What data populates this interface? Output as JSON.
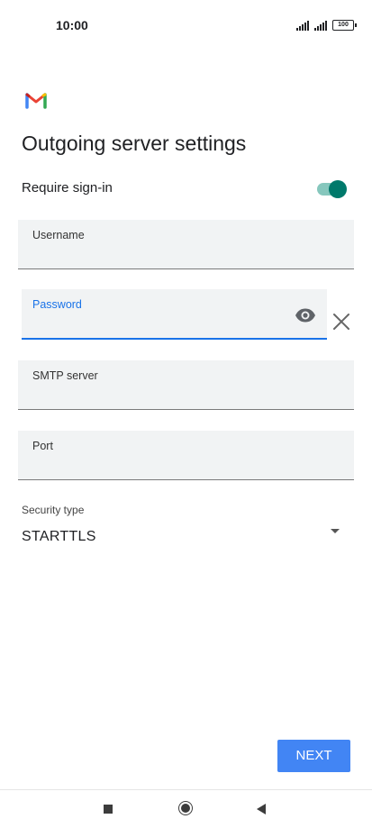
{
  "status_bar": {
    "time": "10:00",
    "battery": "100"
  },
  "header": {
    "title": "Outgoing server settings"
  },
  "require_signin": {
    "label": "Require sign-in",
    "enabled": true
  },
  "fields": {
    "username": {
      "label": "Username",
      "value": ""
    },
    "password": {
      "label": "Password",
      "value": ""
    },
    "smtp": {
      "label": "SMTP server",
      "value": ""
    },
    "port": {
      "label": "Port",
      "value": ""
    }
  },
  "security": {
    "label": "Security type",
    "value": "STARTTLS"
  },
  "actions": {
    "next_label": "NEXT"
  },
  "icons": [
    "gmail-logo",
    "eye-icon",
    "close-icon",
    "dropdown-arrow-icon",
    "signal-icon",
    "battery-icon",
    "nav-square-icon",
    "nav-home-icon",
    "nav-back-icon"
  ],
  "colors": {
    "accent": "#1a73e8",
    "button": "#4285f4",
    "switch_on": "#00796b"
  }
}
